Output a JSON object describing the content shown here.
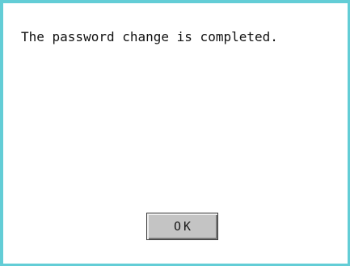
{
  "dialog": {
    "message": "The password change is completed.",
    "ok_label": "OK",
    "border_color": "#63cdd6"
  }
}
